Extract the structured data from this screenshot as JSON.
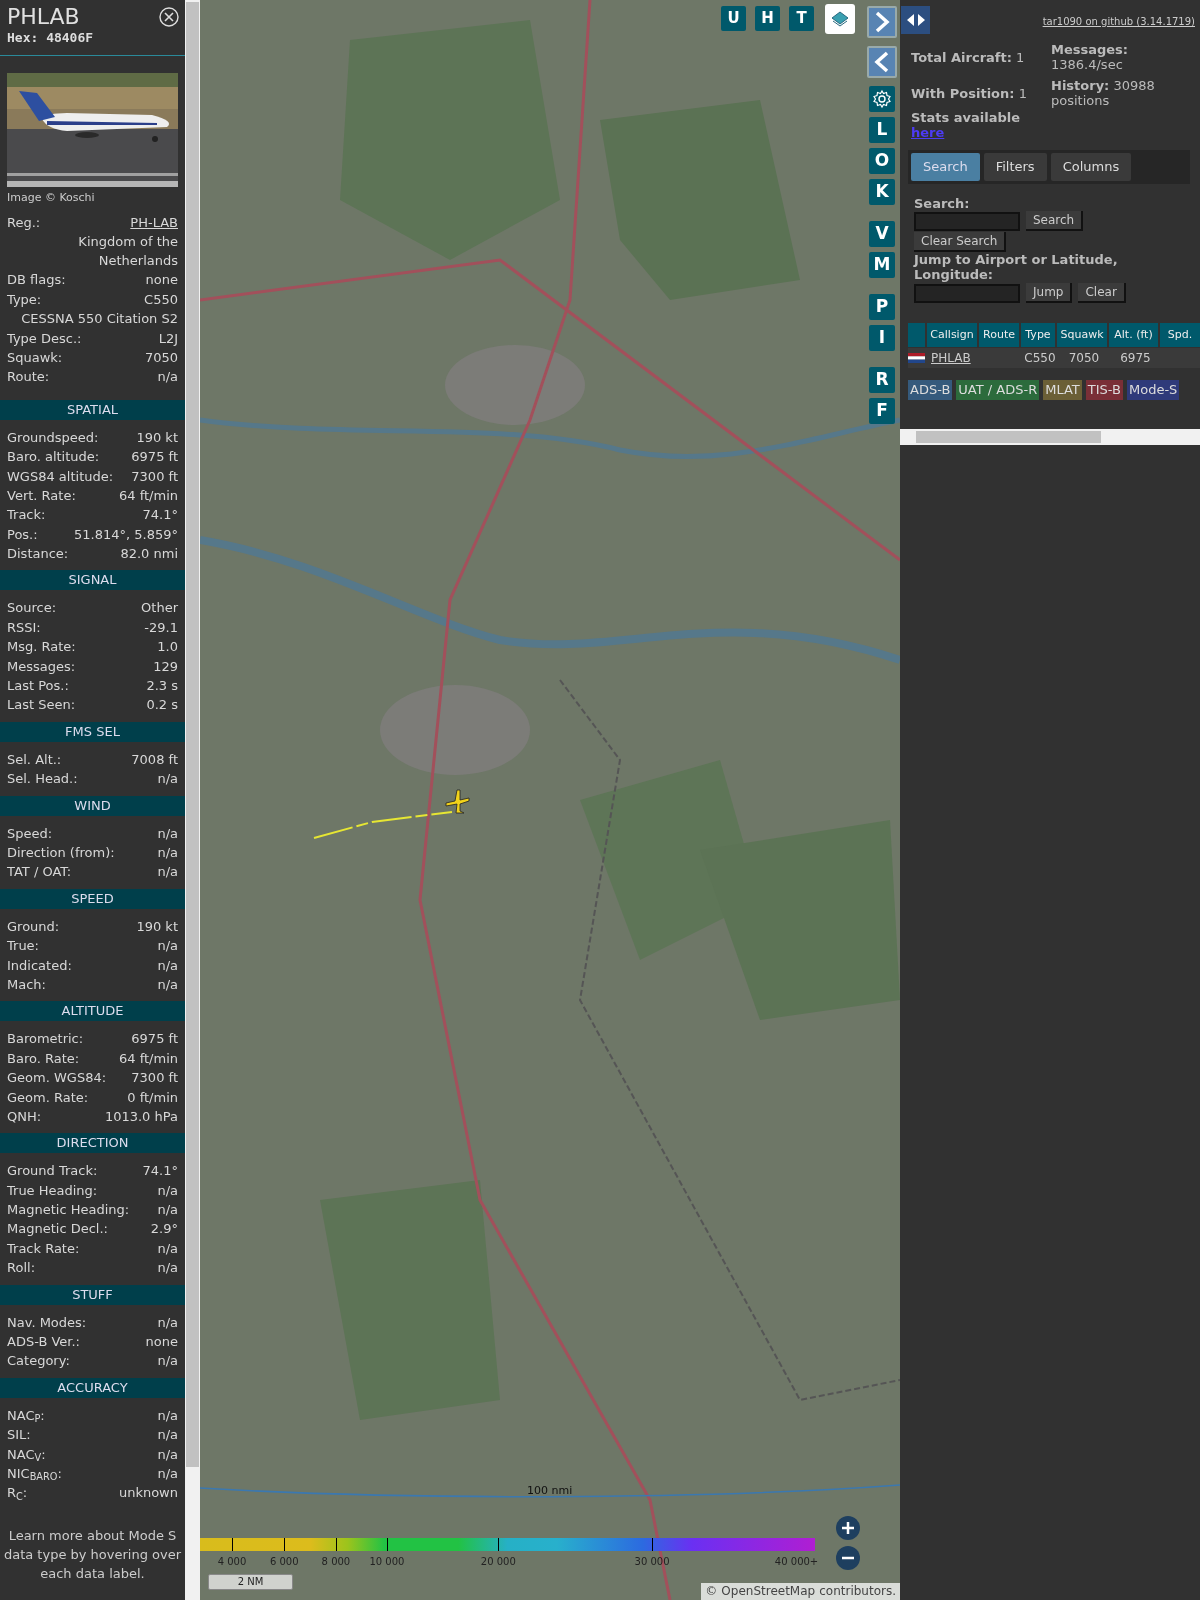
{
  "details": {
    "callsign": "PHLAB",
    "hex": "Hex: 48406F",
    "photo_credit": "Image © Koschi",
    "rows": [
      {
        "kind": "pair",
        "label": "Reg.:",
        "value": "PH-LAB",
        "link": true
      },
      {
        "kind": "value",
        "value": "Kingdom of the Netherlands"
      },
      {
        "kind": "pair",
        "label": "DB flags:",
        "value": "none",
        "link": false
      },
      {
        "kind": "pair",
        "label": "Type:",
        "value": "C550",
        "link": false
      },
      {
        "kind": "value",
        "value": "CESSNA 550 Citation S2"
      },
      {
        "kind": "pair",
        "label": "Type Desc.:",
        "value": "L2J",
        "link": false
      },
      {
        "kind": "pair",
        "label": "Squawk:",
        "value": "7050",
        "link": false
      },
      {
        "kind": "pair",
        "label": "Route:",
        "value": "n/a",
        "link": false
      }
    ],
    "sections": [
      {
        "title": "SPATIAL",
        "rows": [
          {
            "label": "Groundspeed:",
            "value": "190 kt"
          },
          {
            "label": "Baro. altitude:",
            "value": "6975 ft"
          },
          {
            "label": "WGS84 altitude:",
            "value": "7300 ft"
          },
          {
            "label": "Vert. Rate:",
            "value": "64 ft/min"
          },
          {
            "label": "Track:",
            "value": "74.1°"
          },
          {
            "label": "Pos.:",
            "value": "51.814°, 5.859°"
          },
          {
            "label": "Distance:",
            "value": "82.0 nmi"
          }
        ]
      },
      {
        "title": "SIGNAL",
        "rows": [
          {
            "label": "Source:",
            "value": "Other"
          },
          {
            "label": "RSSI:",
            "value": "-29.1"
          },
          {
            "label": "Msg. Rate:",
            "value": "1.0"
          },
          {
            "label": "Messages:",
            "value": "129"
          },
          {
            "label": "Last Pos.:",
            "value": "2.3 s"
          },
          {
            "label": "Last Seen:",
            "value": "0.2 s"
          }
        ]
      },
      {
        "title": "FMS SEL",
        "rows": [
          {
            "label": "Sel. Alt.:",
            "value": "7008 ft"
          },
          {
            "label": "Sel. Head.:",
            "value": "n/a"
          }
        ]
      },
      {
        "title": "WIND",
        "rows": [
          {
            "label": "Speed:",
            "value": "n/a"
          },
          {
            "label": "Direction (from):",
            "value": "n/a"
          },
          {
            "label": "TAT / OAT:",
            "value": "n/a"
          }
        ]
      },
      {
        "title": "SPEED",
        "rows": [
          {
            "label": "Ground:",
            "value": "190 kt"
          },
          {
            "label": "True:",
            "value": "n/a"
          },
          {
            "label": "Indicated:",
            "value": "n/a"
          },
          {
            "label": "Mach:",
            "value": "n/a"
          }
        ]
      },
      {
        "title": "ALTITUDE",
        "rows": [
          {
            "label": "Barometric:",
            "value": "6975 ft"
          },
          {
            "label": "Baro. Rate:",
            "value": "64 ft/min"
          },
          {
            "label": "Geom. WGS84:",
            "value": "7300 ft"
          },
          {
            "label": "Geom. Rate:",
            "value": "0 ft/min"
          },
          {
            "label": "QNH:",
            "value": "1013.0 hPa"
          }
        ]
      },
      {
        "title": "DIRECTION",
        "rows": [
          {
            "label": "Ground Track:",
            "value": "74.1°"
          },
          {
            "label": "True Heading:",
            "value": "n/a"
          },
          {
            "label": "Magnetic Heading:",
            "value": "n/a"
          },
          {
            "label": "Magnetic Decl.:",
            "value": "2.9°"
          },
          {
            "label": "Track Rate:",
            "value": "n/a"
          },
          {
            "label": "Roll:",
            "value": "n/a"
          }
        ]
      },
      {
        "title": "STUFF",
        "rows": [
          {
            "label": "Nav. Modes:",
            "value": "n/a"
          },
          {
            "label": "ADS-B Ver.:",
            "value": "none"
          },
          {
            "label": "Category:",
            "value": "n/a"
          }
        ]
      },
      {
        "title": "ACCURACY",
        "rows": [
          {
            "label": "NAC$_{P}$:",
            "value": "n/a"
          },
          {
            "label": "SIL:",
            "value": "n/a"
          },
          {
            "label": "NAC$_{V}$:",
            "value": "n/a"
          },
          {
            "label": "NIC$_{BARO}$:",
            "value": "n/a"
          },
          {
            "label": "R$_{C}$:",
            "value": "unknown"
          }
        ]
      }
    ],
    "footer": "Learn more about Mode S data type by hovering over each data label."
  },
  "map": {
    "top_buttons": [
      "U",
      "H",
      "T"
    ],
    "side_button_groups": [
      [
        "L",
        "O",
        "K"
      ],
      [
        "V",
        "M"
      ],
      [
        "P",
        "I"
      ],
      [
        "R",
        "F"
      ]
    ],
    "range_label": "100 nmi",
    "altitude_legend": [
      "4 000",
      "6 000",
      "8 000",
      "10 000",
      "20 000",
      "30 000",
      "40 000+"
    ],
    "scale": "2 NM",
    "attribution": {
      "prefix": "©",
      "link": "OpenStreetMap",
      "suffix": "contributors."
    }
  },
  "panel": {
    "github_link": "tar1090 on github (3.14.1719)",
    "stats": [
      "**Total Aircraft:** 1",
      "**With Position:** 1",
      "**Messages:** 1386.4/sec",
      "**History:** 30988 positions"
    ],
    "stats_label": "Stats available",
    "stats_link": "here",
    "tabs": [
      {
        "label": "Search",
        "selected": true
      },
      {
        "label": "Filters",
        "selected": false
      },
      {
        "label": "Columns",
        "selected": false
      }
    ],
    "search_label": "Search:",
    "search_button": "Search",
    "clear_search_button": "Clear Search",
    "jump_label": "Jump to Airport or Latitude, Longitude:",
    "jump_button": "Jump",
    "clear_button": "Clear",
    "table": {
      "columns": [
        "Callsign",
        "Route",
        "Type",
        "Squawk",
        "Alt. (ft)",
        "Spd."
      ],
      "rows": [
        {
          "callsign": "PHLAB",
          "route": "",
          "type": "C550",
          "squawk": "7050",
          "altitude": "6975"
        }
      ]
    },
    "legend": [
      {
        "label": "ADS-B",
        "color": "#355a7c"
      },
      {
        "label": "UAT / ADS-R",
        "color": "#2c6b3c"
      },
      {
        "label": "MLAT",
        "color": "#6b5f36"
      },
      {
        "label": "TIS-B",
        "color": "#7a2f37"
      },
      {
        "label": "Mode-S",
        "color": "#2f3a7a"
      }
    ]
  }
}
